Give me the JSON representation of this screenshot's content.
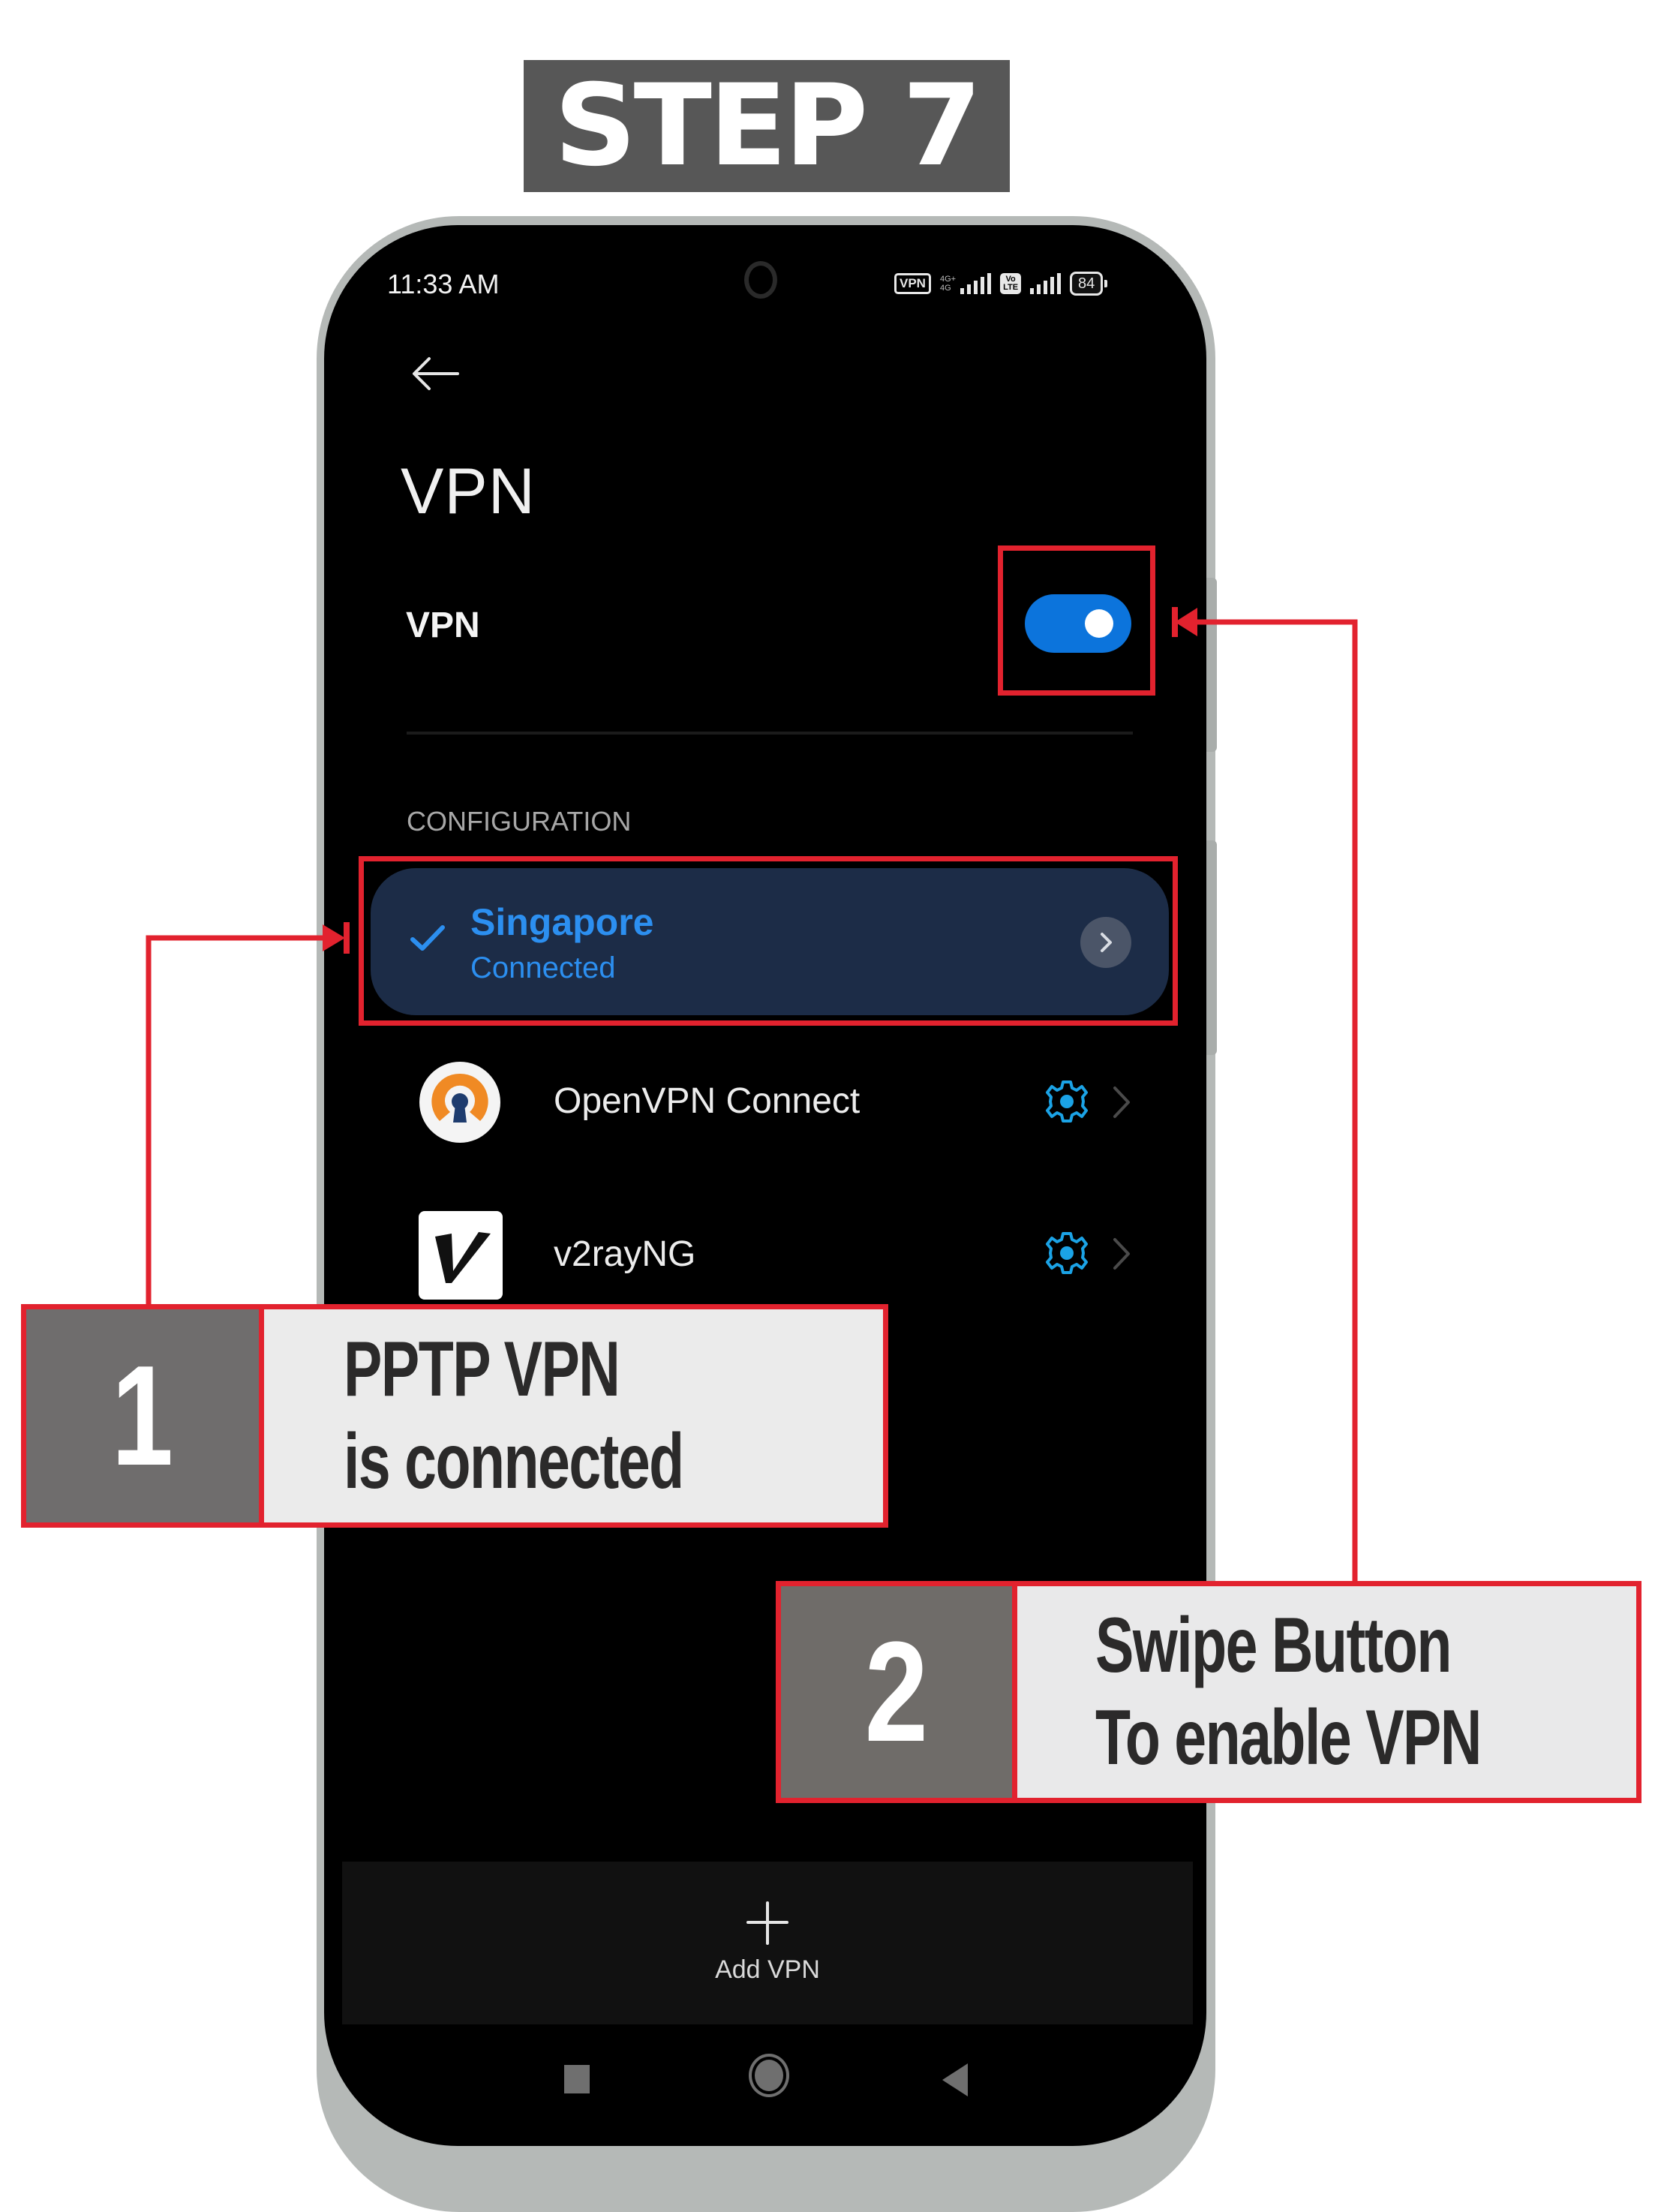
{
  "banner": {
    "title": "STEP 7"
  },
  "status_bar": {
    "time": "11:33 AM",
    "vpn_badge": "VPN",
    "network_type_top": "4G+",
    "network_type_bottom": "4G",
    "volte_top": "Vo",
    "volte_bottom": "LTE",
    "battery": "84"
  },
  "header": {
    "back_icon": "arrow-left-icon",
    "title": "VPN"
  },
  "vpn_toggle": {
    "label": "VPN",
    "state": "on",
    "accent_color": "#0c74dc"
  },
  "configuration": {
    "section_label": "CONFIGURATION",
    "active_profile": {
      "name": "Singapore",
      "status": "Connected",
      "selected": true,
      "text_color": "#2c8ff0",
      "card_color": "#1c2c47"
    },
    "apps": [
      {
        "name": "OpenVPN Connect",
        "icon": "openvpn-logo-icon"
      },
      {
        "name": "v2rayNG",
        "icon": "v2rayng-logo-icon"
      }
    ]
  },
  "add_vpn": {
    "label": "Add VPN",
    "icon": "plus-icon"
  },
  "navigation": [
    "recents-icon",
    "home-icon",
    "back-triangle-icon"
  ],
  "callouts": [
    {
      "number": "1",
      "lines": [
        "PPTP VPN",
        "is connected"
      ]
    },
    {
      "number": "2",
      "lines": [
        "Swipe Button",
        "To enable VPN"
      ]
    }
  ],
  "annotation_color": "#e2222e"
}
